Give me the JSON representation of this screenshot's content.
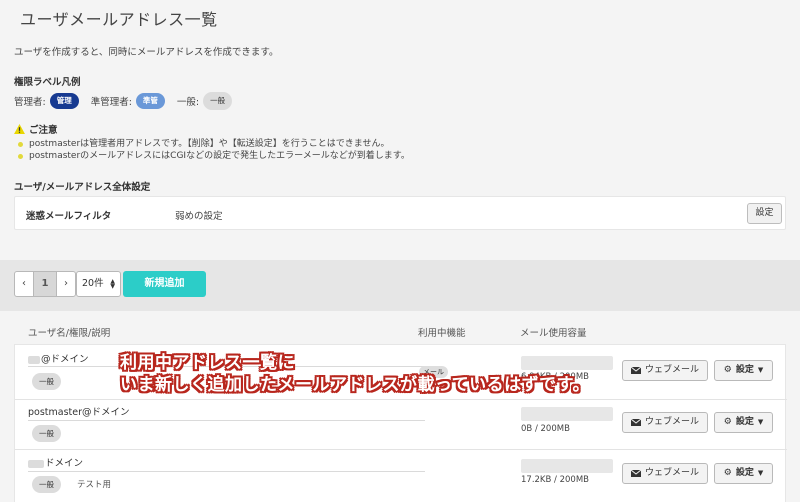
{
  "page": {
    "title": "ユーザメールアドレス一覧",
    "intro": "ユーザを作成すると、同時にメールアドレスを作成できます。"
  },
  "legend": {
    "title": "権限ラベル凡例",
    "admin_label": "管理者:",
    "admin_badge": "管理",
    "sub_label": "準管理者:",
    "sub_badge": "準管",
    "general_label": "一般:",
    "general_badge": "一般",
    "colors": {
      "admin": "#173a91",
      "sub_admin": "#6a98d8",
      "general": "#dcdcdc"
    }
  },
  "notice": {
    "title": "ご注意",
    "items": [
      "postmasterは管理者用アドレスです。【削除】や【転送設定】を行うことはできません。",
      "postmasterのメールアドレスにはCGIなどの設定で発生したエラーメールなどが到着します。"
    ]
  },
  "global_settings": {
    "heading": "ユーザ/メールアドレス全体設定",
    "spam_filter_label": "迷惑メールフィルタ",
    "spam_filter_value": "弱めの設定",
    "button": "設定"
  },
  "toolbar": {
    "prev": "‹",
    "current_page": "1",
    "next": "›",
    "per_page": "20件",
    "add_button": "新規追加",
    "accent_color": "#2ccdc8"
  },
  "columns": {
    "user": "ユーザ名/権限/説明",
    "functions": "利用中機能",
    "usage": "メール使用容量"
  },
  "rows": [
    {
      "name": "@ドメイン",
      "role": "一般",
      "description": "",
      "function": "メール",
      "usage": "6.94KB / 200MB",
      "webmail": "ウェブメール",
      "settings": "設定"
    },
    {
      "name": "postmaster@ドメイン",
      "role": "一般",
      "description": "",
      "function": "",
      "usage": "0B / 200MB",
      "webmail": "ウェブメール",
      "settings": "設定"
    },
    {
      "name": "ドメイン",
      "role": "一般",
      "description": "テスト用",
      "function": "",
      "usage": "17.2KB / 200MB",
      "webmail": "ウェブメール",
      "settings": "設定"
    }
  ],
  "annotation": {
    "line1": "利用中アドレス一覧に",
    "line2": "いま新しく追加したメールアドレスが載っているはずです。",
    "color": "#b8261d"
  }
}
